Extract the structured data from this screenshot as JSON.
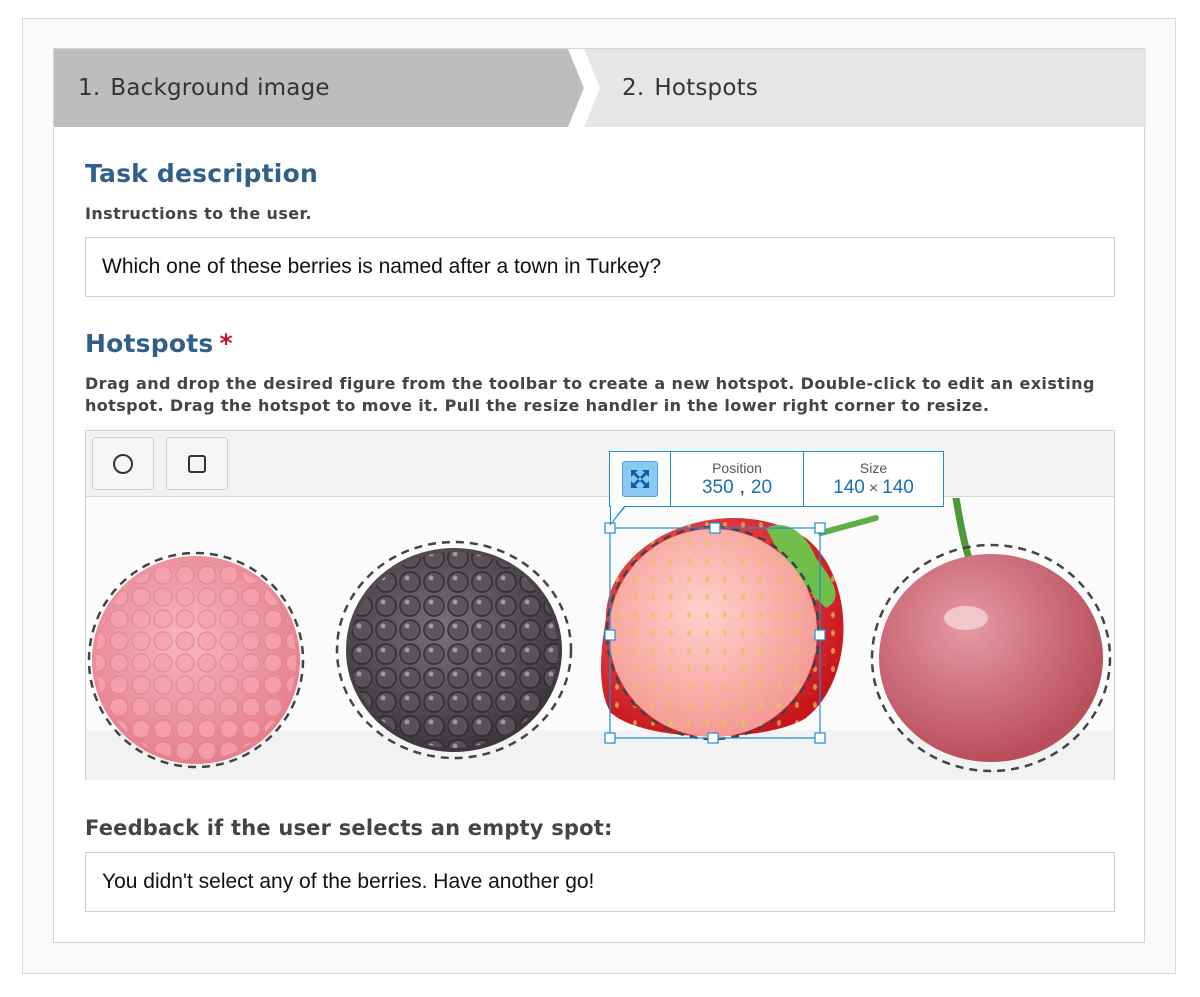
{
  "steps": [
    {
      "number": "1.",
      "label": "Background image"
    },
    {
      "number": "2.",
      "label": "Hotspots"
    }
  ],
  "task": {
    "title": "Task description",
    "help": "Instructions to the user.",
    "value": "Which one of these berries is named after a town in Turkey?"
  },
  "hotspots": {
    "title": "Hotspots",
    "required_mark": "*",
    "help": "Drag and drop the desired figure from the toolbar to create a new hotspot. Double-click to edit an existing hotspot. Drag the hotspot to move it. Pull the resize handler in the lower right corner to resize.",
    "tools": [
      {
        "name": "circle-tool",
        "icon": "circle-icon"
      },
      {
        "name": "rectangle-tool",
        "icon": "square-icon"
      }
    ],
    "popover": {
      "position_label": "Position",
      "position_x": "350",
      "position_separator": ",",
      "position_y": "20",
      "size_label": "Size",
      "size_w": "140",
      "size_times": "×",
      "size_h": "140"
    },
    "berries": [
      "raspberry",
      "blackberry",
      "strawberry",
      "cherry"
    ]
  },
  "feedback": {
    "label": "Feedback if the user selects an empty spot:",
    "value": "You didn't select any of the berries. Have another go!"
  },
  "colors": {
    "accent": "#2f5f8a",
    "required": "#c8102e",
    "selection": "#1a8fd6"
  }
}
